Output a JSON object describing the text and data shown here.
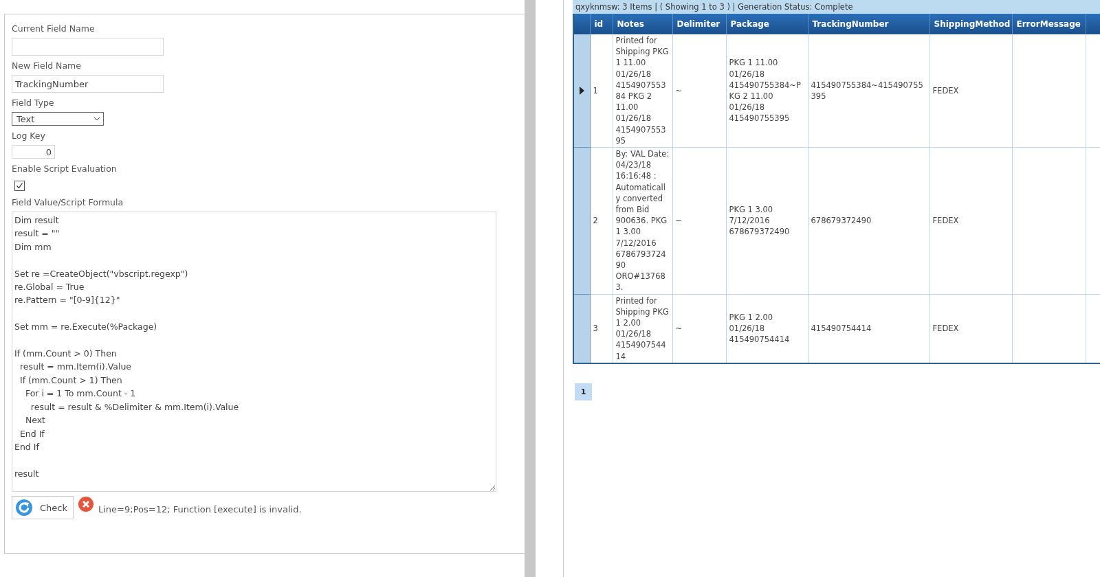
{
  "form": {
    "fields": [
      {
        "kind": "text",
        "label": "Current Field Name"
      },
      {
        "kind": "text",
        "label": "New Field Name",
        "value": "TrackingNumber"
      },
      {
        "kind": "select",
        "label": "Field Type",
        "value": "Text"
      },
      {
        "kind": "number",
        "label": "Log Key",
        "value": "0"
      },
      {
        "kind": "checkbox",
        "label": "Enable Script Evaluation",
        "checked": true
      },
      {
        "kind": "code",
        "label": "Field Value/Script Formula",
        "value": "Dim result\nresult = \"\"\nDim mm\n\nSet re =CreateObject(\"vbscript.regexp\")\nre.Global = True\nre.Pattern = \"[0-9]{12}\"\n\nSet mm = re.Execute(%Package)\n\nIf (mm.Count > 0) Then\n  result = mm.Item(i).Value\n  If (mm.Count > 1) Then\n    For i = 1 To mm.Count - 1\n      result = result & %Delimiter & mm.Item(i).Value\n    Next\n  End If\nEnd If\n\nresult"
      }
    ],
    "check_button": "Check",
    "error_message": "Line=9;Pos=12; Function [execute] is invalid."
  },
  "grid": {
    "status": "qxyknmsw: 3 Items | ( Showing 1 to 3 ) | Generation Status: Complete",
    "columns": [
      "id",
      "Notes",
      "Delimiter",
      "Package",
      "TrackingNumber",
      "ShippingMethod",
      "ErrorMessage"
    ],
    "rows": [
      {
        "selected": true,
        "cells": [
          "1",
          "Printed for Shipping PKG 1 11.00 01/26/18 415490755384 PKG 2 11.00 01/26/18 415490755395",
          "~",
          "PKG 1 11.00 01/26/18 415490755384~PKG 2 11.00 01/26/18 415490755395",
          "415490755384~415490755395",
          "FEDEX"
        ]
      },
      {
        "selected": false,
        "cells": [
          "2",
          "By: VAL Date: 04/23/18 16:16:48 : Automatically converted from Bid 900636. PKG 1 3.00 7/12/2016 678679372490 ORO#137683.",
          "~",
          "PKG 1 3.00 7/12/2016 678679372490",
          "678679372490",
          "FEDEX"
        ]
      },
      {
        "selected": false,
        "cells": [
          "3",
          "Printed for Shipping PKG 1 2.00 01/26/18 415490754414",
          "~",
          "PKG 1 2.00 01/26/18 415490754414",
          "415490754414",
          "FEDEX"
        ]
      }
    ]
  },
  "pager": [
    {
      "label": "1",
      "selected": true
    }
  ]
}
